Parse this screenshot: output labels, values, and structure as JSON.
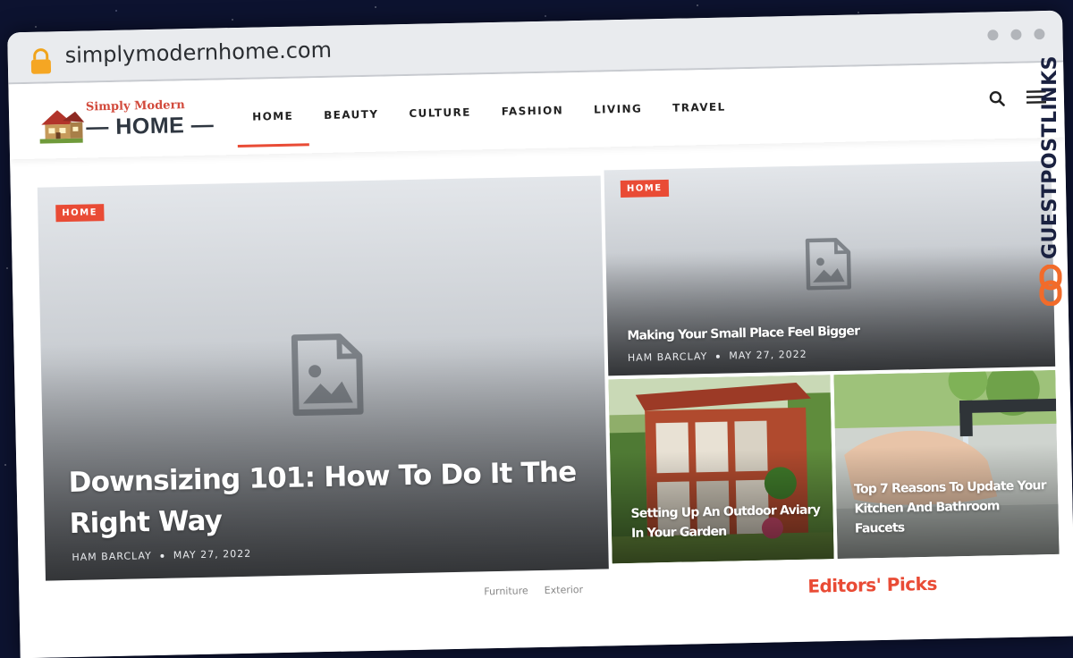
{
  "browser": {
    "url": "simplymodernhome.com",
    "icons": {
      "lock": "lock-icon",
      "window_dots": "window-control-dots"
    }
  },
  "header": {
    "logo": {
      "line1": "Simply Modern",
      "line2": "— HOME —",
      "icon": "house-logo-icon"
    },
    "nav": [
      {
        "label": "HOME",
        "active": true
      },
      {
        "label": "BEAUTY",
        "active": false
      },
      {
        "label": "CULTURE",
        "active": false
      },
      {
        "label": "FASHION",
        "active": false
      },
      {
        "label": "LIVING",
        "active": false
      },
      {
        "label": "TRAVEL",
        "active": false
      }
    ],
    "icons": {
      "search": "search-icon",
      "menu": "hamburger-menu-icon"
    }
  },
  "featured": {
    "main": {
      "category": "HOME",
      "title": "Downsizing 101: How To Do It The Right Way",
      "author": "HAM BARCLAY",
      "date": "MAY 27, 2022"
    },
    "top_right": {
      "category": "HOME",
      "title": "Making Your Small Place Feel Bigger",
      "author": "HAM BARCLAY",
      "date": "MAY 27, 2022"
    },
    "aviary": {
      "title": "Setting Up An Outdoor Aviary In Your Garden"
    },
    "faucet": {
      "title": "Top 7 Reasons To Update Your Kitchen And Bathroom Faucets"
    }
  },
  "below": {
    "links": [
      "Furniture",
      "Exterior"
    ],
    "editors_picks": "Editors' Picks"
  },
  "watermark": {
    "text": "GUESTPOSTLINKS"
  },
  "colors": {
    "accent": "#e94b35",
    "logo_red": "#d24a3c",
    "text_dark": "#222222"
  }
}
